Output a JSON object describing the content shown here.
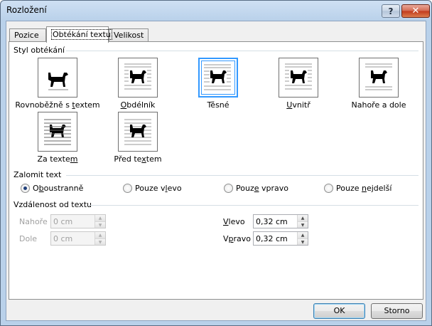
{
  "window": {
    "title": "Rozložení",
    "help_glyph": "?",
    "close_glyph": "✕"
  },
  "tabs": [
    {
      "label": "Pozice"
    },
    {
      "label": "Obtékání textu"
    },
    {
      "label": "Velikost"
    }
  ],
  "wrap_style": {
    "section_label": "Styl obtékání",
    "options": [
      {
        "pre": "Rovnoběžně s ",
        "key": "t",
        "post": "extem"
      },
      {
        "pre": "",
        "key": "O",
        "post": "bdélník"
      },
      {
        "pre": "Těsné",
        "key": "",
        "post": ""
      },
      {
        "pre": "",
        "key": "U",
        "post": "vnitř"
      },
      {
        "pre": "Nahoře a dole",
        "key": "",
        "post": ""
      },
      {
        "pre": "Za texte",
        "key": "m",
        "post": ""
      },
      {
        "pre": "Před te",
        "key": "x",
        "post": "tem"
      }
    ]
  },
  "wrap_text": {
    "section_label": "Zalomit text",
    "options": [
      {
        "pre": "O",
        "key": "b",
        "post": "oustranně"
      },
      {
        "pre": "Pouze v",
        "key": "l",
        "post": "evo"
      },
      {
        "pre": "Pouz",
        "key": "e",
        "post": " vpravo"
      },
      {
        "pre": "Pouze ",
        "key": "n",
        "post": "ejdelší"
      }
    ]
  },
  "distance": {
    "section_label": "Vzdálenost od textu",
    "top_label": "Nahoře",
    "top_value": "0 cm",
    "bottom_label": "Dole",
    "bottom_value": "0 cm",
    "left_key": "V",
    "left_rest": "levo",
    "left_value": "0,32 cm",
    "right_pre": "V",
    "right_key": "p",
    "right_post": "ravo",
    "right_value": "0,32 cm"
  },
  "buttons": {
    "ok": "OK",
    "cancel": "Storno"
  },
  "colors": {
    "selected_border": "#3399ff",
    "title_bar": "#b9d1ea",
    "close_button": "#c1391b"
  }
}
